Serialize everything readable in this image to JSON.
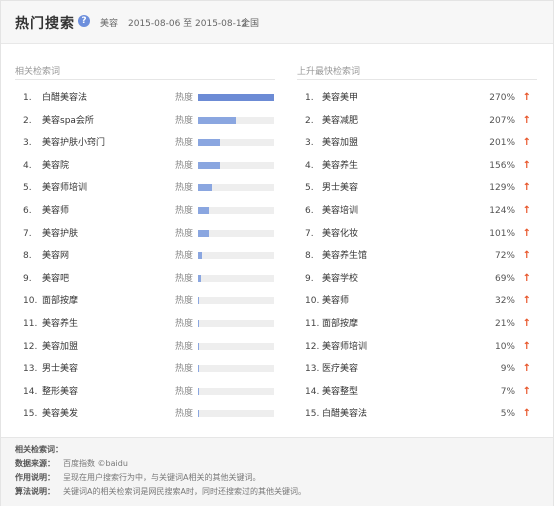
{
  "header": {
    "title": "热门搜索",
    "keyword": "美容",
    "date_range": "2015-08-06 至 2015-08-12",
    "region": "全国"
  },
  "related": {
    "title": "相关检索词",
    "heat_label": "热度",
    "items": [
      {
        "rank": "1.",
        "keyword": "白醋美容法",
        "heat": 1.0
      },
      {
        "rank": "2.",
        "keyword": "美容spa会所",
        "heat": 0.5
      },
      {
        "rank": "3.",
        "keyword": "美容护肤小窍门",
        "heat": 0.29
      },
      {
        "rank": "4.",
        "keyword": "美容院",
        "heat": 0.29
      },
      {
        "rank": "5.",
        "keyword": "美容师培训",
        "heat": 0.18
      },
      {
        "rank": "6.",
        "keyword": "美容师",
        "heat": 0.15
      },
      {
        "rank": "7.",
        "keyword": "美容护肤",
        "heat": 0.14
      },
      {
        "rank": "8.",
        "keyword": "美容网",
        "heat": 0.05
      },
      {
        "rank": "9.",
        "keyword": "美容吧",
        "heat": 0.04
      },
      {
        "rank": "10.",
        "keyword": "面部按摩",
        "heat": 0.015
      },
      {
        "rank": "11.",
        "keyword": "美容养生",
        "heat": 0.015
      },
      {
        "rank": "12.",
        "keyword": "美容加盟",
        "heat": 0.015
      },
      {
        "rank": "13.",
        "keyword": "男士美容",
        "heat": 0.015
      },
      {
        "rank": "14.",
        "keyword": "整形美容",
        "heat": 0.015
      },
      {
        "rank": "15.",
        "keyword": "美容美发",
        "heat": 0.015
      }
    ]
  },
  "rising": {
    "title": "上升最快检索词",
    "items": [
      {
        "rank": "1.",
        "keyword": "美容美甲",
        "pct": "270%"
      },
      {
        "rank": "2.",
        "keyword": "美容减肥",
        "pct": "207%"
      },
      {
        "rank": "3.",
        "keyword": "美容加盟",
        "pct": "201%"
      },
      {
        "rank": "4.",
        "keyword": "美容养生",
        "pct": "156%"
      },
      {
        "rank": "5.",
        "keyword": "男士美容",
        "pct": "129%"
      },
      {
        "rank": "6.",
        "keyword": "美容培训",
        "pct": "124%"
      },
      {
        "rank": "7.",
        "keyword": "美容化妆",
        "pct": "101%"
      },
      {
        "rank": "8.",
        "keyword": "美容养生馆",
        "pct": "72%"
      },
      {
        "rank": "9.",
        "keyword": "美容学校",
        "pct": "69%"
      },
      {
        "rank": "10.",
        "keyword": "美容师",
        "pct": "32%"
      },
      {
        "rank": "11.",
        "keyword": "面部按摩",
        "pct": "21%"
      },
      {
        "rank": "12.",
        "keyword": "美容师培训",
        "pct": "10%"
      },
      {
        "rank": "13.",
        "keyword": "医疗美容",
        "pct": "9%"
      },
      {
        "rank": "14.",
        "keyword": "美容整型",
        "pct": "7%"
      },
      {
        "rank": "15.",
        "keyword": "白醋美容法",
        "pct": "5%"
      }
    ]
  },
  "footer": {
    "heading": "相关检索词：",
    "source_label": "数据来源：",
    "source_text": "百度指数 ©baidu",
    "purpose_label": "作用说明：",
    "purpose_text": "呈现在用户搜索行为中，与关键词A相关的其他关键词。",
    "algo_label": "算法说明：",
    "algo_text": "关键词A的相关检索词是网民搜索A时，同时还搜索过的其他关键词。"
  },
  "colors": {
    "bar": "#8aa6e0",
    "bar_top": "#6c8bd5",
    "up_arrow": "#e8562a",
    "help_icon": "#6d8fdc"
  },
  "icons": {
    "help": "question-circle-icon",
    "up": "arrow-up-icon"
  }
}
